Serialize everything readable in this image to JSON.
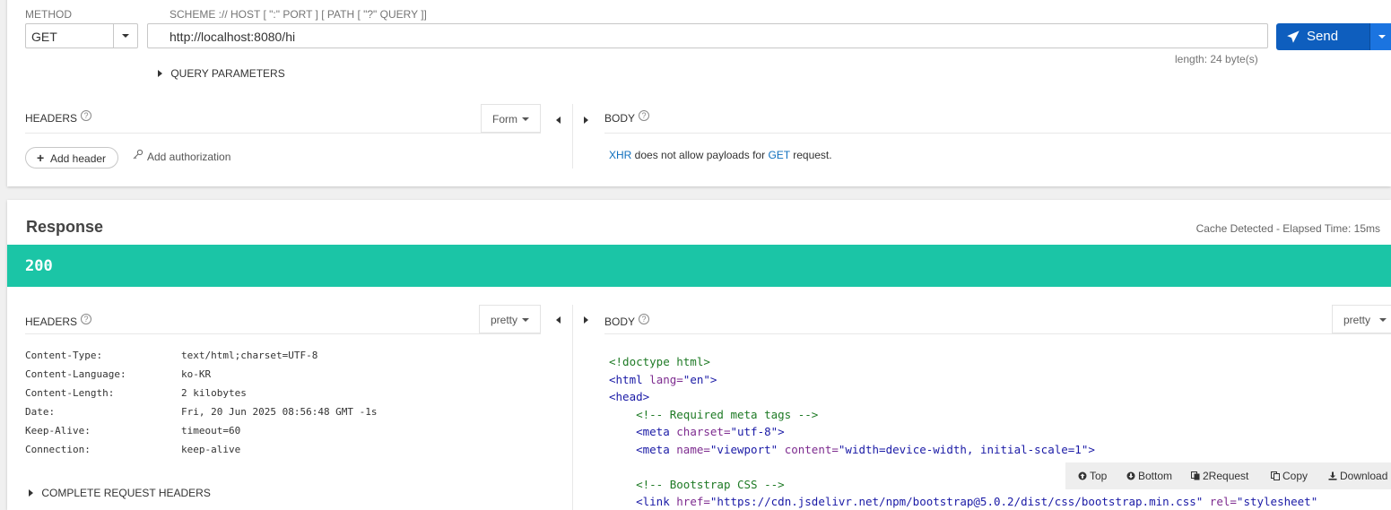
{
  "request": {
    "method_label": "METHOD",
    "method_value": "GET",
    "scheme_label": "SCHEME :// HOST [ \":\" PORT ] [ PATH [ \"?\" QUERY ]]",
    "url_value": "http://localhost:8080/hi",
    "send_label": "Send",
    "length_text": "length: 24 byte(s)",
    "query_params_label": "QUERY PARAMETERS",
    "headers_label": "HEADERS",
    "headers_format": "Form",
    "add_header_label": "Add header",
    "add_authorization_label": "Add authorization",
    "body_label": "BODY",
    "body_msg": {
      "part1": "XHR",
      "part2": " does not allow payloads for ",
      "part3": "GET",
      "part4": " request."
    }
  },
  "response": {
    "title": "Response",
    "meta": "Cache Detected - Elapsed Time: 15ms",
    "status_code": "200",
    "headers_label": "HEADERS",
    "headers_format": "pretty",
    "body_label": "BODY",
    "body_format": "pretty",
    "headers": [
      {
        "key": "Content-Type:",
        "value": "text/html;charset=UTF-8"
      },
      {
        "key": "Content-Language:",
        "value": "ko-KR"
      },
      {
        "key": "Content-Length:",
        "value": "2 kilobytes"
      },
      {
        "key": "Date:",
        "value": "Fri, 20 Jun 2025 08:56:48 GMT -1s"
      },
      {
        "key": "Keep-Alive:",
        "value": "timeout=60"
      },
      {
        "key": "Connection:",
        "value": "keep-alive"
      }
    ],
    "complete_headers_label": "COMPLETE REQUEST HEADERS",
    "code": {
      "l1": "<!doctype html>",
      "l2_tag": "<html",
      "l2_attr": " lang=",
      "l2_str": "\"en\"",
      "l2_end": ">",
      "l3": "<head>",
      "l4": "<!-- Required meta tags -->",
      "l5_tag": "<meta",
      "l5_attr": " charset=",
      "l5_str": "\"utf-8\"",
      "l5_end": ">",
      "l6_tag": "<meta",
      "l6_attr1": " name=",
      "l6_str1": "\"viewport\"",
      "l6_attr2": " content=",
      "l6_str2": "\"width=device-width, initial-scale=1\"",
      "l6_end": ">",
      "l8": "<!-- Bootstrap CSS -->",
      "l9_tag": "<link",
      "l9_attr1": " href=",
      "l9_str1": "\"https://cdn.jsdelivr.net/npm/bootstrap@5.0.2/dist/css/bootstrap.min.css\"",
      "l9_attr2": " rel=",
      "l9_str2": "\"stylesheet\""
    },
    "toolbar": {
      "top": "Top",
      "bottom": "Bottom",
      "to_request": "2Request",
      "copy": "Copy",
      "download": "Download"
    }
  },
  "colors": {
    "send_button": "#0e5ebe",
    "status_bar": "#1bc5a6",
    "link": "#0e6fbe"
  }
}
